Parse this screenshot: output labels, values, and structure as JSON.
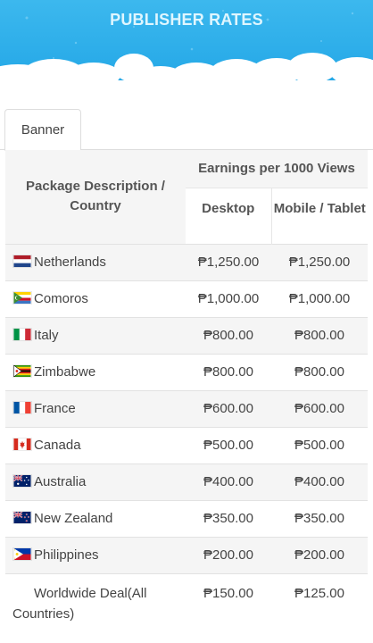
{
  "header": {
    "title": "PUBLISHER RATES",
    "bg_color": "#29aae8"
  },
  "tabs": [
    {
      "label": "Banner",
      "active": true
    }
  ],
  "table": {
    "col_package": "Package Description / Country",
    "col_earnings": "Earnings per 1000 Views",
    "col_desktop": "Desktop",
    "col_mobile": "Mobile / Tablet",
    "rows": [
      {
        "country": "Netherlands",
        "flag": "netherlands-flag-icon",
        "desktop": "₱1,250.00",
        "mobile": "₱1,250.00"
      },
      {
        "country": "Comoros",
        "flag": "comoros-flag-icon",
        "desktop": "₱1,000.00",
        "mobile": "₱1,000.00"
      },
      {
        "country": "Italy",
        "flag": "italy-flag-icon",
        "desktop": "₱800.00",
        "mobile": "₱800.00"
      },
      {
        "country": "Zimbabwe",
        "flag": "zimbabwe-flag-icon",
        "desktop": "₱800.00",
        "mobile": "₱800.00"
      },
      {
        "country": "France",
        "flag": "france-flag-icon",
        "desktop": "₱600.00",
        "mobile": "₱600.00"
      },
      {
        "country": "Canada",
        "flag": "canada-flag-icon",
        "desktop": "₱500.00",
        "mobile": "₱500.00"
      },
      {
        "country": "Australia",
        "flag": "australia-flag-icon",
        "desktop": "₱400.00",
        "mobile": "₱400.00"
      },
      {
        "country": "New Zealand",
        "flag": "new-zealand-flag-icon",
        "desktop": "₱350.00",
        "mobile": "₱350.00"
      },
      {
        "country": "Philippines",
        "flag": "philippines-flag-icon",
        "desktop": "₱200.00",
        "mobile": "₱200.00"
      },
      {
        "country": "Worldwide Deal(All Countries)",
        "flag": "",
        "desktop": "₱150.00",
        "mobile": "₱125.00"
      }
    ]
  }
}
